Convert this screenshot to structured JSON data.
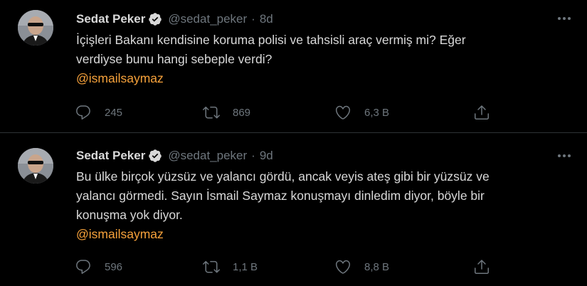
{
  "tweets": [
    {
      "name": "Sedat Peker",
      "handle": "@sedat_peker",
      "separator": "·",
      "time": "8d",
      "lines": [
        "İçişleri Bakanı kendisine koruma polisi ve tahsisli araç vermiş mi? Eğer",
        "verdiyse bunu hangi sebeple verdi?"
      ],
      "mention": "@ismailsaymaz",
      "replies": "245",
      "retweets": "869",
      "likes": "6,3 B"
    },
    {
      "name": "Sedat Peker",
      "handle": "@sedat_peker",
      "separator": "·",
      "time": "9d",
      "lines": [
        "Bu ülke birçok yüzsüz ve yalancı gördü, ancak veyis ateş gibi bir yüzsüz ve",
        "yalancı görmedi. Sayın İsmail Saymaz konuşmayı dinledim diyor, böyle bir",
        "konuşma yok diyor."
      ],
      "mention": "@ismailsaymaz",
      "replies": "596",
      "retweets": "1,1 B",
      "likes": "8,8 B"
    }
  ],
  "colors": {
    "background": "#000000",
    "text": "#d9d9d9",
    "muted": "#6e767d",
    "mention": "#f7a23b",
    "verified": "#d9d9d9",
    "divider": "#2f3336"
  },
  "icons": {
    "reply": "reply-icon",
    "retweet": "retweet-icon",
    "like": "heart-icon",
    "share": "share-icon",
    "verified": "verified-badge-icon",
    "more": "more-icon"
  }
}
